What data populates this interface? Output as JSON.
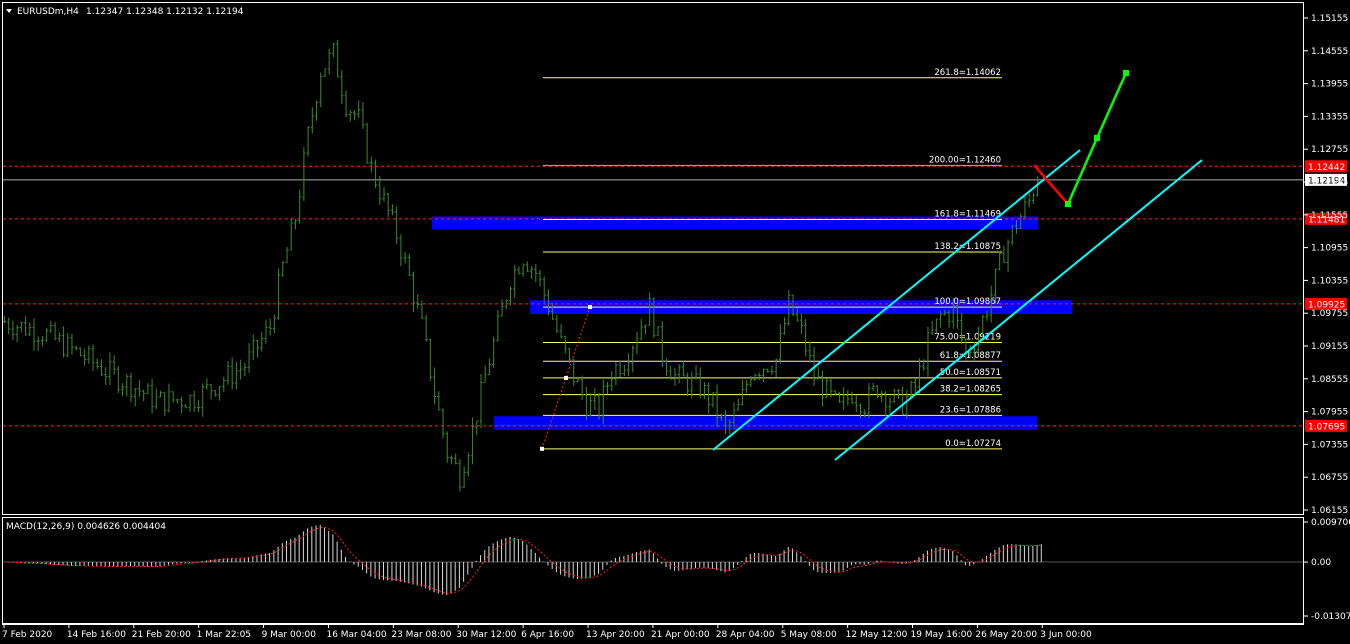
{
  "window": {
    "symbol_label": "EURUSDm,H4",
    "ohlc": "1.12347 1.12348 1.12132 1.12194",
    "menu_icon": "triangle-down-icon"
  },
  "colors": {
    "background": "#000000",
    "candles": "#3a8a2a",
    "grid_lines": "#ffffff",
    "fib_lines": "#ffff66",
    "fib_200": "#ffa500",
    "zones": "#0000ff",
    "channel": "#00ffff",
    "projection_down": "#ff0000",
    "projection_up": "#00ff00",
    "hlines": "#ff2020",
    "macd_hist": "#d8d8d8",
    "macd_signal": "#ff2020",
    "price_tag": "#ff0000"
  },
  "chart_data": [
    {
      "type": "candlestick",
      "name": "EURUSDm,H4",
      "y_axis_ticks": [
        "1.15155",
        "1.14555",
        "1.13955",
        "1.13355",
        "1.12755",
        "1.12155",
        "1.11555",
        "1.10955",
        "1.10355",
        "1.09755",
        "1.09155",
        "1.08555",
        "1.07955",
        "1.07355",
        "1.06755",
        "1.06155"
      ],
      "ylim": [
        1.06155,
        1.15155
      ],
      "x_axis_ticks": [
        "7 Feb 2020",
        "14 Feb 16:00",
        "21 Feb 20:00",
        "1 Mar 22:05",
        "9 Mar 00:00",
        "16 Mar 04:00",
        "23 Mar 08:00",
        "30 Mar 12:00",
        "6 Apr 16:00",
        "13 Apr 20:00",
        "21 Apr 00:00",
        "28 Apr 04:00",
        "5 May 08:00",
        "12 May 12:00",
        "19 May 16:00",
        "26 May 20:00",
        "3 Jun 00:00"
      ],
      "price_path": [
        [
          0,
          1.096
        ],
        [
          3,
          1.094
        ],
        [
          6,
          1.09
        ],
        [
          8,
          1.087
        ],
        [
          10,
          1.0845
        ],
        [
          12,
          1.0815
        ],
        [
          15,
          1.082
        ],
        [
          17,
          1.085
        ],
        [
          19,
          1.088
        ],
        [
          21,
          1.095
        ],
        [
          22,
          1.106
        ],
        [
          23,
          1.115
        ],
        [
          24,
          1.13
        ],
        [
          25,
          1.142
        ],
        [
          26,
          1.145
        ],
        [
          27,
          1.136
        ],
        [
          28,
          1.133
        ],
        [
          29,
          1.124
        ],
        [
          30,
          1.118
        ],
        [
          31,
          1.112
        ],
        [
          32,
          1.104
        ],
        [
          33,
          1.095
        ],
        [
          34,
          1.083
        ],
        [
          35,
          1.072
        ],
        [
          36,
          1.068
        ],
        [
          37,
          1.076
        ],
        [
          38,
          1.086
        ],
        [
          39,
          1.095
        ],
        [
          40,
          1.104
        ],
        [
          41,
          1.108
        ],
        [
          42,
          1.105
        ],
        [
          43,
          1.099
        ],
        [
          44,
          1.092
        ],
        [
          45,
          1.086
        ],
        [
          46,
          1.081
        ],
        [
          47,
          1.08
        ],
        [
          48,
          1.087
        ],
        [
          49,
          1.089
        ],
        [
          50,
          1.094
        ],
        [
          51,
          1.0985
        ],
        [
          52,
          1.09
        ],
        [
          53,
          1.086
        ],
        [
          54,
          1.085
        ],
        [
          55,
          1.084
        ],
        [
          56,
          1.081
        ],
        [
          57,
          1.076
        ],
        [
          58,
          1.08
        ],
        [
          59,
          1.087
        ],
        [
          60,
          1.088
        ],
        [
          61,
          1.089
        ],
        [
          62,
          1.099
        ],
        [
          63,
          1.094
        ],
        [
          64,
          1.086
        ],
        [
          65,
          1.083
        ],
        [
          66,
          1.08
        ],
        [
          67,
          1.083
        ],
        [
          68,
          1.081
        ],
        [
          69,
          1.084
        ],
        [
          70,
          1.082
        ],
        [
          71,
          1.081
        ],
        [
          72,
          1.084
        ],
        [
          73,
          1.092
        ],
        [
          74,
          1.097
        ],
        [
          75,
          1.098
        ],
        [
          76,
          1.09
        ],
        [
          77,
          1.094
        ],
        [
          78,
          1.101
        ],
        [
          79,
          1.109
        ],
        [
          80,
          1.114
        ],
        [
          81,
          1.118
        ],
        [
          82,
          1.125
        ]
      ]
    },
    {
      "type": "bar",
      "name": "MACD(12,26,9)",
      "header_label": "MACD(12,26,9) 0.004626 0.004404",
      "y_axis_ticks": [
        "0.009706",
        "0.00",
        "-0.013075"
      ],
      "ylim": [
        -0.013075,
        0.009706
      ]
    }
  ],
  "fibonacci": [
    {
      "label": "261.8=1.14062",
      "price": 1.14062
    },
    {
      "label": "200.00=1.12460",
      "price": 1.1246
    },
    {
      "label": "161.8=1.11469",
      "price": 1.11469
    },
    {
      "label": "138.2=1.10875",
      "price": 1.10875
    },
    {
      "label": "100.0=1.09867",
      "price": 1.09867
    },
    {
      "label": "75.00=1.09219",
      "price": 1.09219
    },
    {
      "label": "61.8=1.08877",
      "price": 1.08877
    },
    {
      "label": "50.0=1.08571",
      "price": 1.08571
    },
    {
      "label": "38.2=1.08265",
      "price": 1.08265
    },
    {
      "label": "23.6=1.07886",
      "price": 1.07886
    },
    {
      "label": "0.0=1.07274",
      "price": 1.07274
    }
  ],
  "horizontal_levels": [
    {
      "price_label": "1.12442",
      "price": 1.12442,
      "kind": "dashed-red"
    },
    {
      "price_label": "1.11481",
      "price": 1.11481,
      "kind": "dashed-red"
    },
    {
      "price_label": "1.09925",
      "price": 1.09925,
      "kind": "dashed-red"
    },
    {
      "price_label": "1.07695",
      "price": 1.07695,
      "kind": "dashed-red"
    }
  ],
  "current_price": {
    "label": "1.12194",
    "price": 1.12194
  },
  "support_resistance_zones": [
    {
      "top": 1.11525,
      "bottom": 1.1129
    },
    {
      "top": 1.0999,
      "bottom": 1.0974
    },
    {
      "top": 1.0787,
      "bottom": 1.0762
    }
  ]
}
